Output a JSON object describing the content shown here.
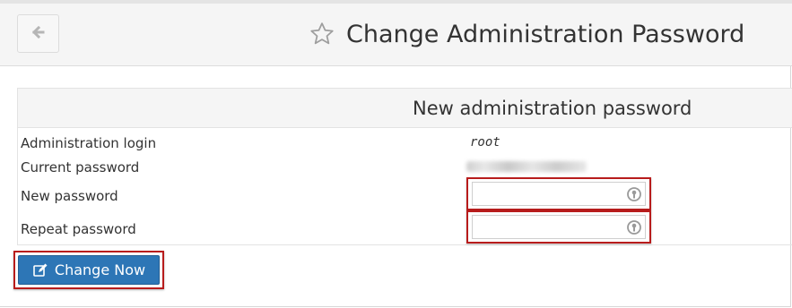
{
  "header": {
    "title": "Change Administration Password",
    "back_icon": "arrow-left-icon",
    "favorite_icon": "star-outline-icon"
  },
  "panel": {
    "title": "New administration password",
    "rows": {
      "admin_login_label": "Administration login",
      "admin_login_value": "root",
      "current_password_label": "Current password",
      "new_password_label": "New password",
      "repeat_password_label": "Repeat password"
    },
    "new_password_value": "",
    "repeat_password_value": ""
  },
  "actions": {
    "change_now_label": "Change Now",
    "change_now_icon": "edit-icon"
  },
  "colors": {
    "highlight": "#b81c1c",
    "primary_button": "#2d76b6"
  }
}
